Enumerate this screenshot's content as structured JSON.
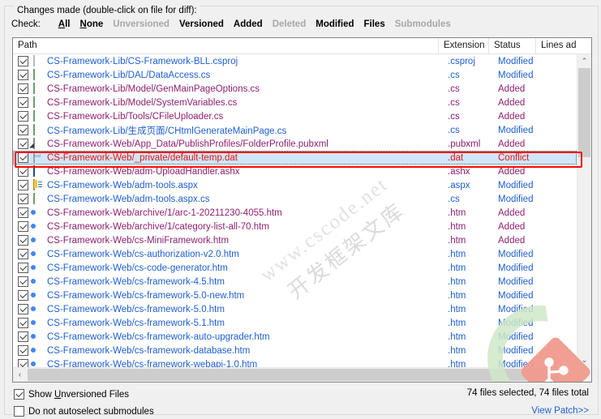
{
  "dialog": {
    "group_title": "Changes made (double-click on file for diff):"
  },
  "check_bar": {
    "label": "Check:",
    "links": [
      {
        "text": "All",
        "enabled": true,
        "mnemonic": "A"
      },
      {
        "text": "None",
        "enabled": true,
        "mnemonic": "N"
      },
      {
        "text": "Unversioned",
        "enabled": false,
        "mnemonic": ""
      },
      {
        "text": "Versioned",
        "enabled": true,
        "mnemonic": ""
      },
      {
        "text": "Added",
        "enabled": true,
        "mnemonic": ""
      },
      {
        "text": "Deleted",
        "enabled": false,
        "mnemonic": ""
      },
      {
        "text": "Modified",
        "enabled": true,
        "mnemonic": ""
      },
      {
        "text": "Files",
        "enabled": true,
        "mnemonic": ""
      },
      {
        "text": "Submodules",
        "enabled": false,
        "mnemonic": ""
      }
    ]
  },
  "columns": [
    {
      "key": "path",
      "label": "Path"
    },
    {
      "key": "extension",
      "label": "Extension"
    },
    {
      "key": "status",
      "label": "Status"
    },
    {
      "key": "lines_added",
      "label": "Lines ad"
    }
  ],
  "rows": [
    {
      "checked": true,
      "icon": "blank-file-icon",
      "path": "CS-Framework-Lib/CS-Framework-BLL.csproj",
      "extension": ".csproj",
      "status": "Modified",
      "lines": "",
      "state": "modified",
      "selected": false
    },
    {
      "checked": true,
      "icon": "cs-file-icon",
      "path": "CS-Framework-Lib/DAL/DataAccess.cs",
      "extension": ".cs",
      "status": "Modified",
      "lines": "",
      "state": "modified",
      "selected": false
    },
    {
      "checked": true,
      "icon": "cs-file-icon",
      "path": "CS-Framework-Lib/Model/GenMainPageOptions.cs",
      "extension": ".cs",
      "status": "Added",
      "lines": "",
      "state": "added",
      "selected": false
    },
    {
      "checked": true,
      "icon": "cs-file-icon",
      "path": "CS-Framework-Lib/Model/SystemVariables.cs",
      "extension": ".cs",
      "status": "Added",
      "lines": "",
      "state": "added",
      "selected": false
    },
    {
      "checked": true,
      "icon": "cs-file-icon",
      "path": "CS-Framework-Lib/Tools/CFileUploader.cs",
      "extension": ".cs",
      "status": "Added",
      "lines": "",
      "state": "added",
      "selected": false
    },
    {
      "checked": true,
      "icon": "cs-file-icon",
      "path": "CS-Framework-Lib/生成页面/CHtmlGenerateMainPage.cs",
      "extension": ".cs",
      "status": "Modified",
      "lines": "",
      "state": "modified",
      "selected": false
    },
    {
      "checked": true,
      "icon": "xml-file-icon",
      "path": "CS-Framework-Web/App_Data/PublishProfiles/FolderProfile.pubxml",
      "extension": ".pubxml",
      "status": "Added",
      "lines": "",
      "state": "added",
      "selected": false
    },
    {
      "checked": true,
      "icon": "dat-file-icon",
      "path": "CS-Framework-Web/_private/default-temp.dat",
      "extension": ".dat",
      "status": "Conflict",
      "lines": "",
      "state": "conflict",
      "selected": true
    },
    {
      "checked": true,
      "icon": "ashx-file-icon",
      "path": "CS-Framework-Web/adm-UploadHandler.ashx",
      "extension": ".ashx",
      "status": "Added",
      "lines": "",
      "state": "added",
      "selected": false
    },
    {
      "checked": true,
      "icon": "aspx-file-icon",
      "path": "CS-Framework-Web/adm-tools.aspx",
      "extension": ".aspx",
      "status": "Modified",
      "lines": "",
      "state": "modified",
      "selected": false
    },
    {
      "checked": true,
      "icon": "cs-file-icon",
      "path": "CS-Framework-Web/adm-tools.aspx.cs",
      "extension": ".cs",
      "status": "Modified",
      "lines": "",
      "state": "modified",
      "selected": false
    },
    {
      "checked": true,
      "icon": "chrome-icon",
      "path": "CS-Framework-Web/archive/1/arc-1-20211230-4055.htm",
      "extension": ".htm",
      "status": "Added",
      "lines": "",
      "state": "added",
      "selected": false
    },
    {
      "checked": true,
      "icon": "chrome-icon",
      "path": "CS-Framework-Web/archive/1/category-list-all-70.htm",
      "extension": ".htm",
      "status": "Added",
      "lines": "",
      "state": "added",
      "selected": false
    },
    {
      "checked": true,
      "icon": "chrome-icon",
      "path": "CS-Framework-Web/cs-MiniFramework.htm",
      "extension": ".htm",
      "status": "Added",
      "lines": "",
      "state": "added",
      "selected": false
    },
    {
      "checked": true,
      "icon": "chrome-icon",
      "path": "CS-Framework-Web/cs-authorization-v2.0.htm",
      "extension": ".htm",
      "status": "Modified",
      "lines": "",
      "state": "modified",
      "selected": false
    },
    {
      "checked": true,
      "icon": "chrome-icon",
      "path": "CS-Framework-Web/cs-code-generator.htm",
      "extension": ".htm",
      "status": "Modified",
      "lines": "",
      "state": "modified",
      "selected": false
    },
    {
      "checked": true,
      "icon": "chrome-icon",
      "path": "CS-Framework-Web/cs-framework-4.5.htm",
      "extension": ".htm",
      "status": "Modified",
      "lines": "",
      "state": "modified",
      "selected": false
    },
    {
      "checked": true,
      "icon": "chrome-icon",
      "path": "CS-Framework-Web/cs-framework-5.0-new.htm",
      "extension": ".htm",
      "status": "Modified",
      "lines": "",
      "state": "modified",
      "selected": false
    },
    {
      "checked": true,
      "icon": "chrome-icon",
      "path": "CS-Framework-Web/cs-framework-5.0.htm",
      "extension": ".htm",
      "status": "Modified",
      "lines": "",
      "state": "modified",
      "selected": false
    },
    {
      "checked": true,
      "icon": "chrome-icon",
      "path": "CS-Framework-Web/cs-framework-5.1.htm",
      "extension": ".htm",
      "status": "Modified",
      "lines": "",
      "state": "modified",
      "selected": false
    },
    {
      "checked": true,
      "icon": "chrome-icon",
      "path": "CS-Framework-Web/cs-framework-auto-upgrader.htm",
      "extension": ".htm",
      "status": "Modified",
      "lines": "",
      "state": "modified",
      "selected": false
    },
    {
      "checked": true,
      "icon": "chrome-icon",
      "path": "CS-Framework-Web/cs-framework-database.htm",
      "extension": ".htm",
      "status": "Modified",
      "lines": "",
      "state": "modified",
      "selected": false
    },
    {
      "checked": true,
      "icon": "chrome-icon",
      "path": "CS-Framework-Web/cs-framework-webapi-1.0.htm",
      "extension": ".htm",
      "status": "Modified",
      "lines": "",
      "state": "modified",
      "selected": false
    }
  ],
  "scrollbars": {
    "vertical": {
      "up_glyph": "⌃",
      "down_glyph": "⌄"
    },
    "horizontal": {
      "left_glyph": "‹",
      "right_glyph": "›"
    }
  },
  "footer": {
    "show_unversioned": {
      "label": "Show Unversioned Files",
      "checked": true,
      "mnemonic": "U"
    },
    "no_autoselect": {
      "label": "Do not autoselect submodules",
      "checked": false
    },
    "file_count": "74 files selected, 74 files total",
    "view_patch": "View Patch>>"
  },
  "watermark": {
    "line1": "www.cscode.net",
    "line2": "开发框架文库"
  },
  "colors": {
    "modified": "#1e5fd0",
    "added": "#8e1f6e",
    "conflict": "#e8130f",
    "selection": "#cfe6fb",
    "annotation": "#f40d05",
    "link": "#1e5fd0"
  }
}
